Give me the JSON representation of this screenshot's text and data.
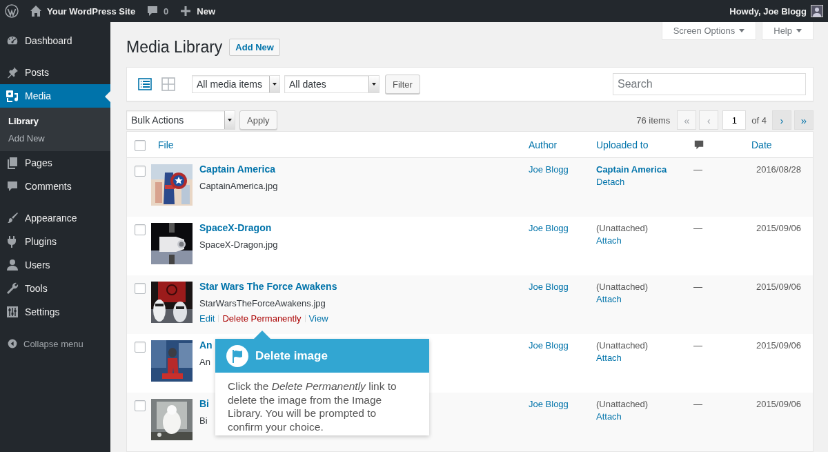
{
  "admin_bar": {
    "site": "Your WordPress Site",
    "comments": "0",
    "new": "New",
    "greeting": "Howdy, Joe Blogg"
  },
  "sidebar": {
    "groups": [
      [
        {
          "label": "Dashboard",
          "selected": false
        }
      ],
      [
        {
          "label": "Posts",
          "selected": false
        },
        {
          "label": "Media",
          "selected": true,
          "children": [
            {
              "label": "Library",
              "selected": true
            },
            {
              "label": "Add New",
              "selected": false
            }
          ]
        },
        {
          "label": "Pages",
          "selected": false
        },
        {
          "label": "Comments",
          "selected": false
        }
      ],
      [
        {
          "label": "Appearance",
          "selected": false
        },
        {
          "label": "Plugins",
          "selected": false
        },
        {
          "label": "Users",
          "selected": false
        },
        {
          "label": "Tools",
          "selected": false
        },
        {
          "label": "Settings",
          "selected": false
        }
      ]
    ],
    "collapse": "Collapse menu"
  },
  "screen_meta": [
    "Screen Options",
    "Help"
  ],
  "page": {
    "title": "Media Library",
    "add_new": "Add New"
  },
  "filters": {
    "views": [
      {
        "kind": "list",
        "selected": true
      },
      {
        "kind": "grid",
        "selected": false
      }
    ],
    "type_select": "All media items",
    "date_select": "All dates",
    "filter_button": "Filter",
    "search": {
      "placeholder": "Search"
    }
  },
  "bulk": {
    "select": "Bulk Actions",
    "apply": "Apply"
  },
  "pagination": {
    "count": "76 items",
    "current_page": "1",
    "total": "of 4",
    "buttons": [
      {
        "label": "«",
        "disabled": true
      },
      {
        "label": "‹",
        "disabled": true
      },
      {
        "label": "›",
        "disabled": false
      },
      {
        "label": "»",
        "disabled": false
      }
    ]
  },
  "table": {
    "select_all": {
      "checked": false
    },
    "columns": [
      {
        "kind": "text",
        "label": "File"
      },
      {
        "kind": "text",
        "label": "Author"
      },
      {
        "kind": "text",
        "label": "Uploaded to"
      },
      {
        "kind": "comments"
      },
      {
        "kind": "text",
        "label": "Date"
      }
    ],
    "rows": [
      {
        "checked": false,
        "title": "Captain America",
        "file": "CaptainAmerica.jpg",
        "author": "Joe Blogg",
        "uploaded_to": {
          "text": "Captain America",
          "attached": true,
          "action": "Detach"
        },
        "comments": "—",
        "date": "2016/08/28"
      },
      {
        "checked": false,
        "title": "SpaceX-Dragon",
        "file": "SpaceX-Dragon.jpg",
        "author": "Joe Blogg",
        "uploaded_to": {
          "text": "(Unattached)",
          "attached": false,
          "action": "Attach"
        },
        "comments": "—",
        "date": "2015/09/06"
      },
      {
        "checked": false,
        "title": "Star Wars The Force Awakens",
        "file": "StarWarsTheForceAwakens.jpg",
        "actions": [
          {
            "label": "Edit",
            "kind": "normal"
          },
          {
            "label": "Delete Permanently",
            "kind": "danger"
          },
          {
            "label": "View",
            "kind": "normal"
          }
        ],
        "author": "Joe Blogg",
        "uploaded_to": {
          "text": "(Unattached)",
          "attached": false,
          "action": "Attach"
        },
        "comments": "—",
        "date": "2015/09/06"
      },
      {
        "checked": false,
        "title": "An",
        "file": "An",
        "author": "Joe Blogg",
        "uploaded_to": {
          "text": "(Unattached)",
          "attached": false,
          "action": "Attach"
        },
        "comments": "—",
        "date": "2015/09/06"
      },
      {
        "checked": false,
        "title": "Bi",
        "file": "Bi",
        "author": "Joe Blogg",
        "uploaded_to": {
          "text": "(Unattached)",
          "attached": false,
          "action": "Attach"
        },
        "comments": "—",
        "date": "2015/09/06"
      }
    ]
  },
  "pointer": {
    "title": "Delete image",
    "text": "Click the *Delete Permanently* link to delete the image from the Image Library. You will be prompted to confirm your choice."
  }
}
